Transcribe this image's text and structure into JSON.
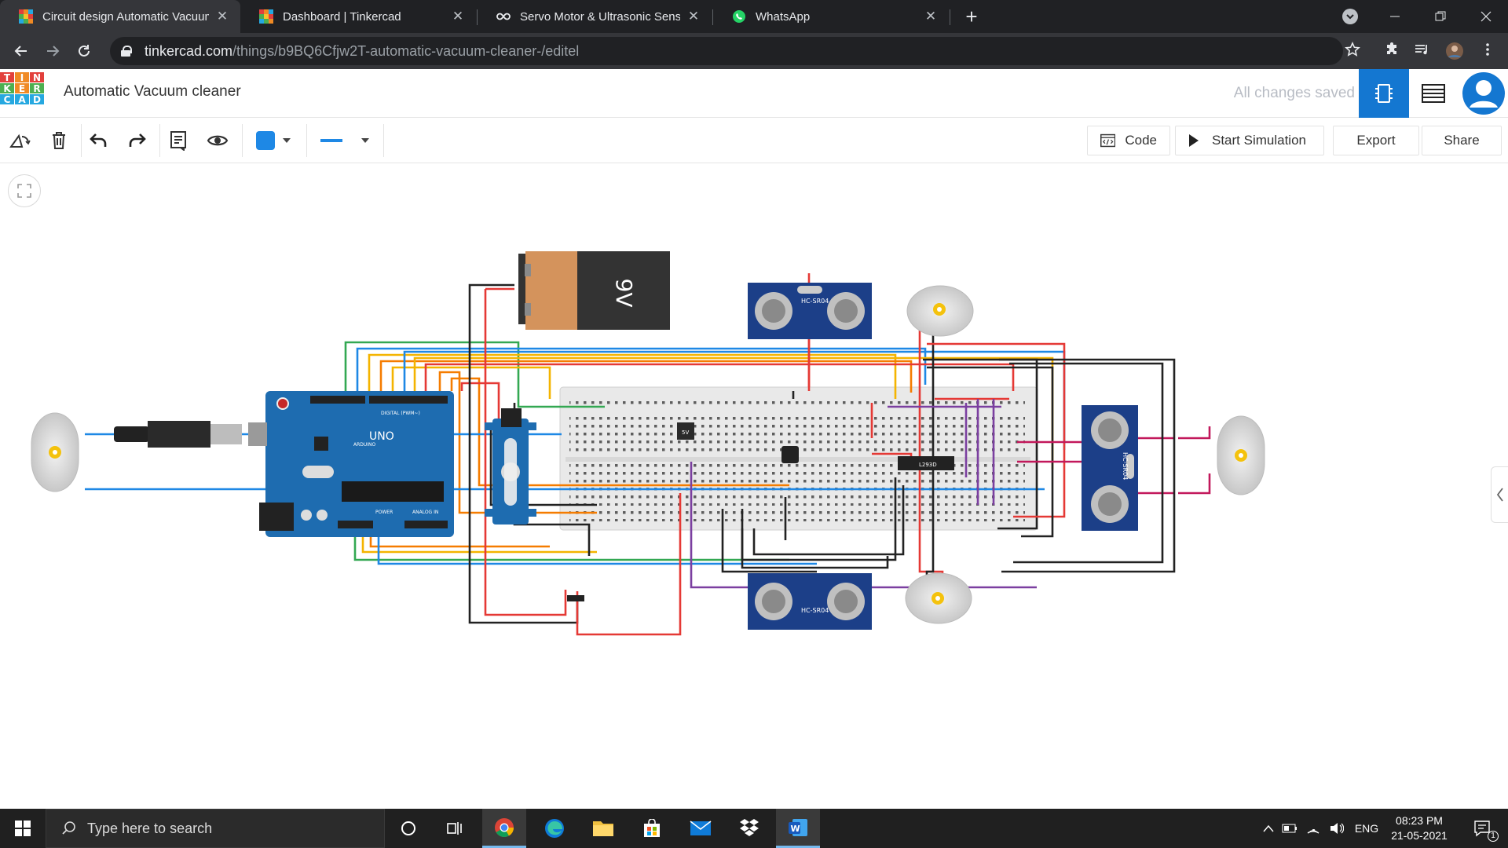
{
  "browser": {
    "tabs": [
      {
        "title": "Circuit design Automatic Vacuum",
        "icon": "tinkercad-icon",
        "active": true
      },
      {
        "title": "Dashboard | Tinkercad",
        "icon": "tinkercad-icon",
        "active": false
      },
      {
        "title": "Servo Motor & Ultrasonic Sensor",
        "icon": "infinity-icon",
        "active": false
      },
      {
        "title": "WhatsApp",
        "icon": "whatsapp-icon",
        "active": false
      }
    ],
    "close_glyph": "✕",
    "new_tab_glyph": "+",
    "url_host": "tinkercad.com",
    "url_path": "/things/b9BQ6Cfjw2T-automatic-vacuum-cleaner-/editel"
  },
  "app": {
    "logo_letters": [
      "T",
      "I",
      "N",
      "K",
      "E",
      "R",
      "C",
      "A",
      "D"
    ],
    "project_title": "Automatic Vacuum cleaner",
    "save_status": "All changes saved",
    "accent_color": "#1477d1"
  },
  "toolbar": {
    "code_label": "Code",
    "simulate_label": "Start Simulation",
    "export_label": "Export",
    "share_label": "Share",
    "fill_color": "#1e88e5"
  },
  "circuit": {
    "battery_label": "9V",
    "sensor_label": "HC-SR04",
    "arduino_label": "UNO",
    "arduino_brand": "ARDUINO",
    "arduino_digital": "DIGITAL (PWM~)",
    "arduino_power": "POWER",
    "arduino_analog": "ANALOG IN",
    "regulator_label": "5V",
    "driver_label": "L293D"
  },
  "taskbar": {
    "search_placeholder": "Type here to search",
    "language": "ENG",
    "time": "08:23 PM",
    "date": "21-05-2021",
    "notification_count": "1"
  }
}
